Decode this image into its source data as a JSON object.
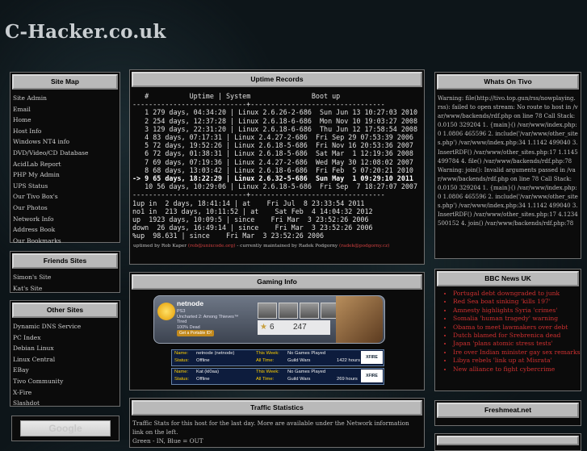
{
  "site": {
    "title": "C-Hacker.co.uk"
  },
  "sitemap": {
    "header": "Site Map",
    "links": [
      "Site Admin",
      "Email",
      "Home",
      "Host Info",
      "Windows NT4 info",
      "DVD/Video/CD Database",
      "AcidLab Report",
      "PHP My Admin",
      "UPS Status",
      "Our Tivo Box's",
      "Our Photos",
      "Network Info",
      "Address Book",
      "Our Bookmarks"
    ]
  },
  "friends": {
    "header": "Friends Sites",
    "links": [
      "Simon's Site",
      "Kat's Site"
    ]
  },
  "other": {
    "header": "Other Sites",
    "links": [
      "Dynamic DNS Service",
      "PC Index",
      "Debian Linux",
      "Linux Central",
      "EBay",
      "Tivo Community",
      "X-Fire",
      "Slashdot"
    ]
  },
  "google": {
    "label": "Google"
  },
  "uptime": {
    "header": "Uptime Records",
    "col_num": "#",
    "col_uptime": "Uptime | System",
    "col_bootup": "Boot up",
    "separator": "----------------------------+---------------------------------",
    "rows": [
      {
        "marker": "",
        "num": "1",
        "uptime": "279 days, 04:34:20",
        "system": "Linux 2.6.26-2-686",
        "boot": "Sun Jun 13 10:27:03 2010"
      },
      {
        "marker": "",
        "num": "2",
        "uptime": "254 days, 12:37:28",
        "system": "Linux 2.6.18-6-686",
        "boot": "Mon Nov 10 19:03:27 2008"
      },
      {
        "marker": "",
        "num": "3",
        "uptime": "129 days, 22:31:20",
        "system": "Linux 2.6.18-6-686",
        "boot": "Thu Jun 12 17:58:54 2008"
      },
      {
        "marker": "",
        "num": "4",
        "uptime": "83 days, 07:17:31",
        "system": "Linux 2.4.27-2-686",
        "boot": "Fri Sep 29 07:53:39 2006"
      },
      {
        "marker": "",
        "num": "5",
        "uptime": "72 days, 19:52:26",
        "system": "Linux 2.6.18-5-686",
        "boot": "Fri Nov 16 20:53:36 2007"
      },
      {
        "marker": "",
        "num": "6",
        "uptime": "72 days, 01:38:31",
        "system": "Linux 2.6.18-5-686",
        "boot": "Sat Mar  1 12:19:36 2008"
      },
      {
        "marker": "",
        "num": "7",
        "uptime": "69 days, 07:19:36",
        "system": "Linux 2.4.27-2-686",
        "boot": "Wed May 30 12:08:02 2007"
      },
      {
        "marker": "",
        "num": "8",
        "uptime": "68 days, 13:03:42",
        "system": "Linux 2.6.18-6-686",
        "boot": "Fri Feb  5 07:20:21 2010"
      },
      {
        "marker": "->",
        "num": "9",
        "uptime": "65 days, 18:22:29",
        "system": "Linux 2.6.32-5-686",
        "boot": "Sun May  1 09:29:10 2011"
      },
      {
        "marker": "",
        "num": "10",
        "uptime": "56 days, 10:29:06",
        "system": "Linux 2.6.18-5-686",
        "boot": "Fri Sep  7 18:27:07 2007"
      }
    ],
    "stats": [
      {
        "label": "1up in",
        "value": "2 days, 18:41:14",
        "sep": "at",
        "date": "Fri Jul  8 23:33:54 2011"
      },
      {
        "label": "no1 in",
        "value": "213 days, 10:11:52",
        "sep": "at",
        "date": "Sat Feb  4 14:04:32 2012"
      },
      {
        "label": "up",
        "value": "1923 days, 10:09:5",
        "sep": "since",
        "date": "Fri Mar  3 23:52:26 2006"
      },
      {
        "label": "down",
        "value": "26 days, 16:49:14",
        "sep": "since",
        "date": "Fri Mar  3 23:52:26 2006"
      },
      {
        "label": "%up",
        "value": "98.631",
        "sep": "since",
        "date": "Fri Mar  3 23:52:26 2006"
      }
    ],
    "credit_prefix": "uptimed by Rob Kaper",
    "credit_email1": "(rob@unixcode.org)",
    "credit_mid": "- currently maintained by Radek Podgorny",
    "credit_email2": "(radek@podgorny.cz)"
  },
  "gaming": {
    "header": "Gaming Info",
    "card": {
      "name": "netnode",
      "platform": "PS3",
      "game": "Uncharted 2: Among Thieves™",
      "detail1": "Tired",
      "detail2": "100% Dead",
      "cta": "Get a Portable ID!",
      "trophies": "6",
      "points": "247"
    },
    "xfire": [
      {
        "name_label": "Name:",
        "name": "netnode (netnode)",
        "status_label": "Status:",
        "status": "Offline",
        "week_label": "This Week:",
        "week": "No Games Played",
        "all_label": "All Time:",
        "all_game": "Guild Wars",
        "all_hours": "1422 hours",
        "logo": "XFIRE"
      },
      {
        "name_label": "Name:",
        "name": "Kat (kl0aa)",
        "status_label": "Status:",
        "status": "Offline",
        "week_label": "This Week:",
        "week": "No Games Played",
        "all_label": "All Time:",
        "all_game": "Guild Wars",
        "all_hours": "269 hours",
        "logo": "XFIRE"
      }
    ]
  },
  "traffic": {
    "header": "Traffic Statistics",
    "text": "Traffic Stats for this host for the last day. More are available under the Network information link on the left.",
    "legend": "Green - IN, Blue = OUT"
  },
  "tivo": {
    "header": "Whats On Tivo",
    "text": "Warning: file(http://tivo.top.gun/rss/nowplaying.rss): failed to open stream: No route to host in /var/www/backends/rdf.php on line 78 Call Stack: 0.0150 329204 1. {main}() /var/www/index.php:0 1.0806 465596 2. include('/var/www/other_sites.php') /var/www/index.php:34 1.1142 499040 3. InsertRDF() /var/www/other_sites.php:17 1.1145 499784 4. file() /var/www/backends/rdf.php:78 Warning: join(): Invalid arguments passed in /var/www/backends/rdf.php on line 78 Call Stack: 0.0150 329204 1. {main}() /var/www/index.php:0 1.0806 465596 2. include('/var/www/other_sites.php') /var/www/index.php:34 1.1142 499040 3. InsertRDF() /var/www/other_sites.php:17 4.1234 500152 4. join() /var/www/backends/rdf.php:78"
  },
  "bbc": {
    "header": "BBC News UK",
    "items": [
      "Portugal debt downgraded to junk",
      "Red Sea boat sinking 'kills 197'",
      "Amnesty highlights Syria 'crimes'",
      "Somalia 'human tragedy' warning",
      "Obama to meet lawmakers over debt",
      "Dutch blamed for Srebrenica dead",
      "Japan 'plans atomic stress tests'",
      "Ire over Indian minister gay sex remarks",
      "Libya rebels 'link up at Misrata'",
      "New alliance to fight cybercrime"
    ]
  },
  "freshmeat": {
    "header": "Freshmeat.net"
  },
  "colors": {
    "accent_red": "#d03030",
    "header_grey": "#b9b9b9"
  }
}
